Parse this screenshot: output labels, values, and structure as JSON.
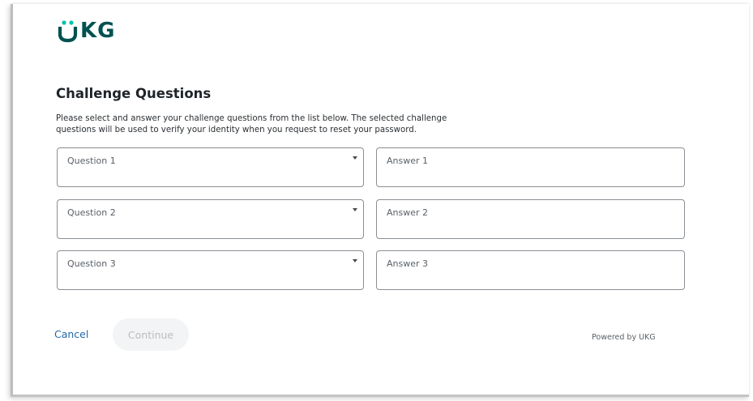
{
  "brand": {
    "logo_text": "UKG",
    "color": "#005151"
  },
  "page": {
    "title": "Challenge Questions",
    "description": "Please select and answer your challenge questions from the list below. The selected challenge questions will be used to verify your identity when you request to reset your password."
  },
  "questions": [
    {
      "placeholder": "Question 1",
      "icon": "caret-down-icon"
    },
    {
      "placeholder": "Question 2",
      "icon": "caret-down-icon"
    },
    {
      "placeholder": "Question 3",
      "icon": "caret-down-icon"
    }
  ],
  "answers": [
    {
      "placeholder": "Answer 1"
    },
    {
      "placeholder": "Answer 2"
    },
    {
      "placeholder": "Answer 3"
    }
  ],
  "actions": {
    "cancel_label": "Cancel",
    "continue_label": "Continue",
    "continue_disabled": true,
    "link_color": "#2469a8"
  },
  "footer": {
    "powered_by": "Powered by UKG"
  }
}
